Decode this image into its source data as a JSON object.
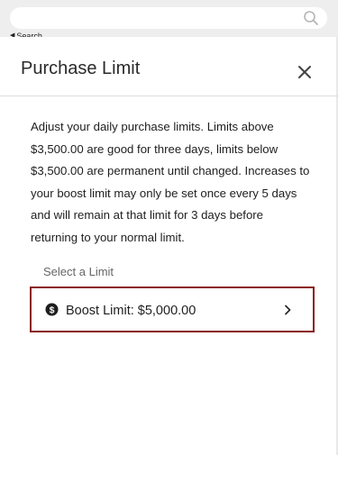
{
  "topbar": {
    "search_placeholder": "",
    "back_label": "Search"
  },
  "modal": {
    "title": "Purchase Limit",
    "description": "Adjust your daily purchase limits. Limits above $3,500.00 are good for three days, limits below $3,500.00 are permanent until changed. Increases to your boost limit may only be set once every 5 days and will remain at that limit for 3 days before returning to your normal limit.",
    "select_label": "Select a Limit",
    "option": {
      "label": "Boost Limit: $5,000.00",
      "icon": "dollar-circle-icon"
    }
  },
  "colors": {
    "option_border": "#8b1a1a",
    "topbar_bg": "#eeeeee"
  }
}
